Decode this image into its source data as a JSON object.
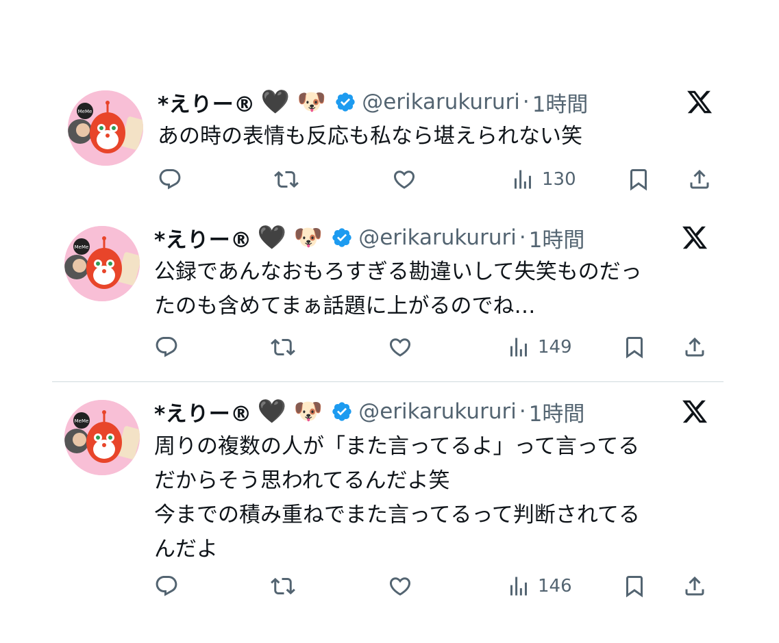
{
  "tweets": [
    {
      "name": "*えりー®",
      "emojis": "🖤 🐶",
      "handle": "@erikarukururi",
      "separator": "·",
      "time": "1時間",
      "text": "あの時の表情も反応も私なら堪えられない笑",
      "views": "130"
    },
    {
      "name": "*えりー®",
      "emojis": "🖤 🐶",
      "handle": "@erikarukururi",
      "separator": "·",
      "time": "1時間",
      "text": "公録であんなおもろすぎる勘違いして失笑ものだっ\nたのも含めてまぁ話題に上がるのでね…",
      "views": "149"
    },
    {
      "name": "*えりー®",
      "emojis": "🖤 🐶",
      "handle": "@erikarukururi",
      "separator": "·",
      "time": "1時間",
      "text": "周りの複数の人が「また言ってるよ」って言ってる\nだからそう思われてるんだよ笑\n今までの積み重ねでまた言ってるって判断されてる\nんだよ",
      "views": "146"
    }
  ],
  "avatar_text": "MeMe",
  "colors": {
    "text": "#0f1419",
    "secondary": "#536471",
    "verified": "#1d9bf0",
    "avatar_bg": "#f8bfd6",
    "divider": "#cfd9de"
  },
  "icons": [
    "reply-icon",
    "retweet-icon",
    "like-icon",
    "views-icon",
    "bookmark-icon",
    "share-icon",
    "x-logo-icon",
    "verified-badge-icon"
  ]
}
